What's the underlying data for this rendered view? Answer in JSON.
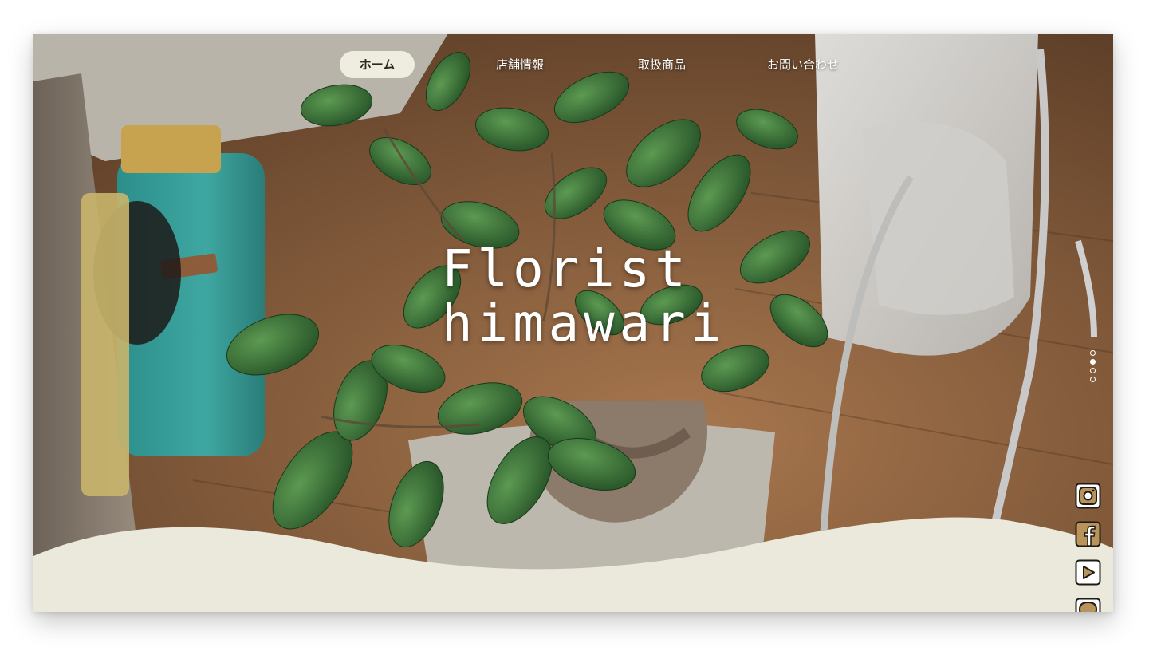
{
  "nav": {
    "items": [
      {
        "label": "ホーム",
        "active": true
      },
      {
        "label": "店舗情報",
        "active": false
      },
      {
        "label": "取扱商品",
        "active": false
      },
      {
        "label": "お問い合わせ",
        "active": false
      }
    ]
  },
  "hero": {
    "logo_line1": "Florist",
    "logo_line2": "himawari"
  },
  "slider": {
    "current": 2,
    "total": 4
  },
  "social": {
    "icons": [
      "instagram-icon",
      "facebook-icon",
      "youtube-icon",
      "chat-bubble-icon"
    ]
  },
  "colors": {
    "accent": "#efede0",
    "icon_fill": "#b8935a",
    "icon_stroke": "#1e1a14",
    "wave": "#ebe9dc"
  }
}
